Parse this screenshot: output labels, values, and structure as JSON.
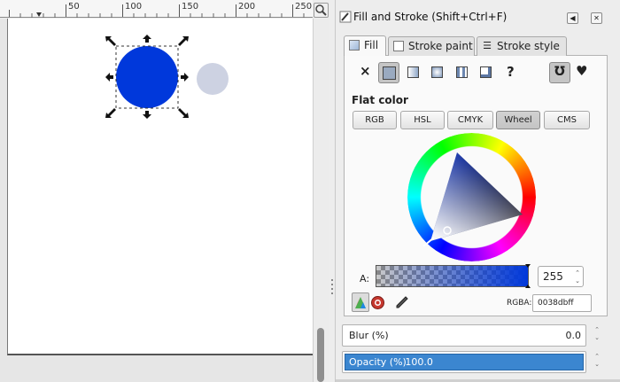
{
  "ruler": {
    "labels": [
      "50",
      "100",
      "150",
      "200",
      "250"
    ]
  },
  "canvas": {
    "selected_circle_color": "#0038db",
    "other_circle_color": "#cdd2e2"
  },
  "panel": {
    "title": "Fill and Stroke (Shift+Ctrl+F)",
    "tabs": [
      "Fill",
      "Stroke paint",
      "Stroke style"
    ],
    "active_tab": "Fill",
    "paint_modes": [
      {
        "name": "no-paint",
        "symbol": "×"
      },
      {
        "name": "flat-color",
        "symbol": ""
      },
      {
        "name": "linear-gradient",
        "symbol": ""
      },
      {
        "name": "radial-gradient",
        "symbol": ""
      },
      {
        "name": "pattern",
        "symbol": ""
      },
      {
        "name": "swatch",
        "symbol": ""
      },
      {
        "name": "unset",
        "symbol": "?"
      }
    ],
    "fill_rule_symbols": [
      "Ʊ",
      "♥"
    ],
    "section_label": "Flat color",
    "color_modes": [
      "RGB",
      "HSL",
      "CMYK",
      "Wheel",
      "CMS"
    ],
    "active_color_mode": "Wheel",
    "alpha_label": "A:",
    "alpha_value": "255",
    "rgba_label": "RGBA:",
    "rgba_value": "0038dbff",
    "blur_label": "Blur (%)",
    "blur_value": "0.0",
    "opacity_label": "Opacity (%)",
    "opacity_value": "100.0",
    "opacity_fraction": 1.0
  }
}
